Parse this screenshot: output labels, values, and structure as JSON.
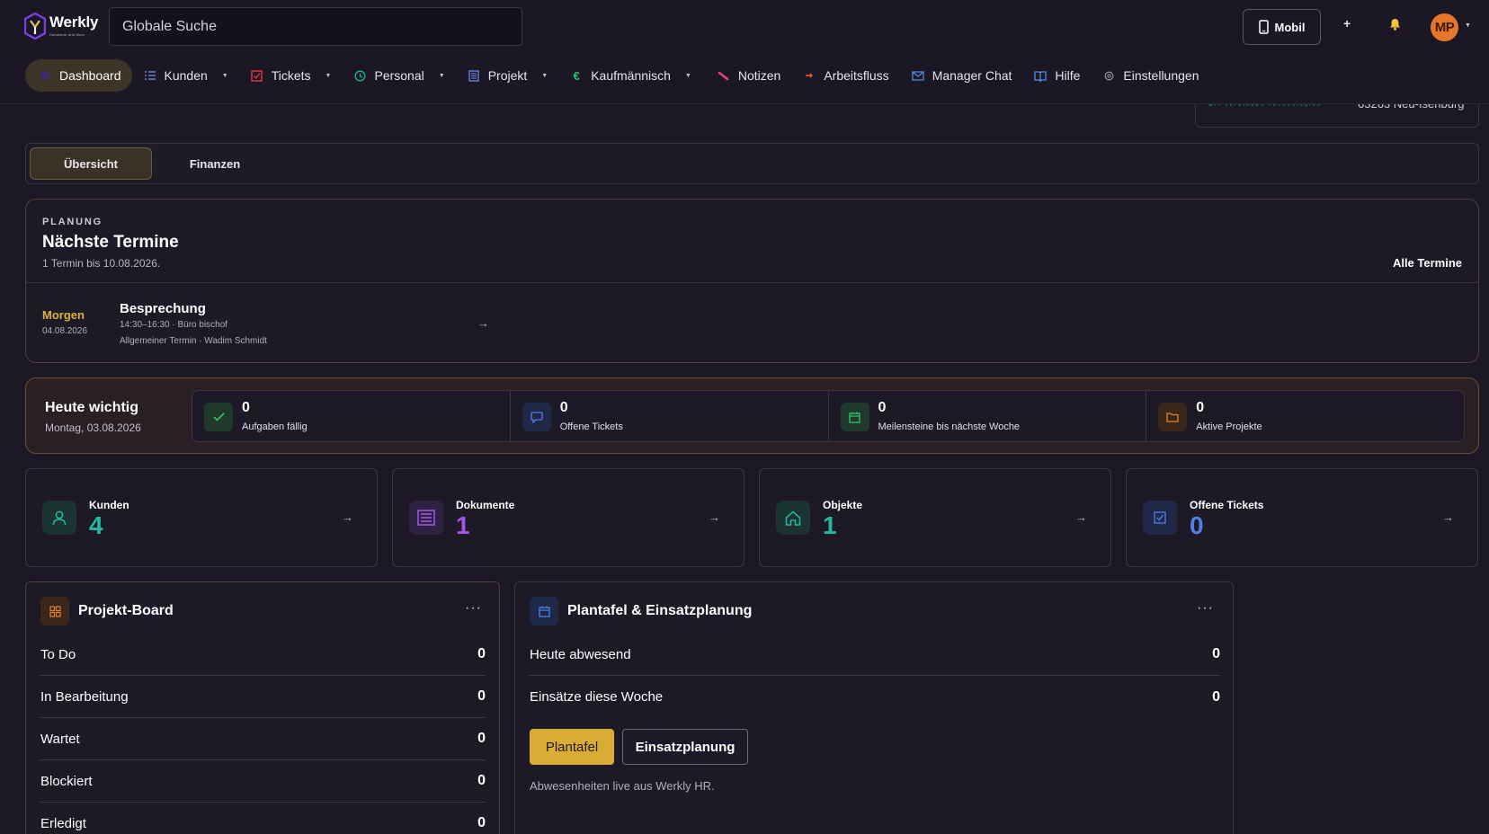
{
  "app": {
    "logo_text": "Werkly",
    "logo_sub": "Handwerk and More"
  },
  "search": {
    "placeholder": "Globale Suche"
  },
  "header": {
    "mobil_label": "Mobil",
    "plus_label": "+",
    "avatar_initials": "MP"
  },
  "nav": [
    {
      "label": "Dashboard",
      "icon": "dashboard-icon",
      "dropdown": false,
      "active": true
    },
    {
      "label": "Kunden",
      "icon": "list-icon",
      "dropdown": true
    },
    {
      "label": "Tickets",
      "icon": "checkbox-icon",
      "dropdown": true
    },
    {
      "label": "Personal",
      "icon": "clock-icon",
      "dropdown": true
    },
    {
      "label": "Projekt",
      "icon": "document-icon",
      "dropdown": true
    },
    {
      "label": "Kaufmännisch",
      "icon": "euro-icon",
      "dropdown": true
    },
    {
      "label": "Notizen",
      "icon": "pen-icon",
      "dropdown": false
    },
    {
      "label": "Arbeitsfluss",
      "icon": "flow-icon",
      "dropdown": false
    },
    {
      "label": "Manager Chat",
      "icon": "mail-icon",
      "dropdown": false
    },
    {
      "label": "Hilfe",
      "icon": "book-icon",
      "dropdown": false
    },
    {
      "label": "Einstellungen",
      "icon": "gear-icon",
      "dropdown": false
    }
  ],
  "address": {
    "slogan": "Wir verbinden Technologien",
    "city": "63263 Neu-Isenburg"
  },
  "tabs": {
    "overview": "Übersicht",
    "finance": "Finanzen"
  },
  "termine": {
    "kicker": "PLANUNG",
    "title": "Nächste Termine",
    "subtitle": "1 Termin bis 10.08.2026.",
    "all_link": "Alle Termine",
    "event": {
      "when": "Morgen",
      "date": "04.08.2026",
      "title": "Besprechung",
      "line1": "14:30–16:30 · Büro bischof",
      "line2": "Allgemeiner Termin · Wadim Schmidt"
    }
  },
  "heute": {
    "title": "Heute wichtig",
    "date": "Montag, 03.08.2026",
    "stats": [
      {
        "value": "0",
        "label": "Aufgaben fällig",
        "icon": "check-icon",
        "color": "#35c46a"
      },
      {
        "value": "0",
        "label": "Offene Tickets",
        "icon": "chat-icon",
        "color": "#4f7fe8"
      },
      {
        "value": "0",
        "label": "Meilensteine bis nächste Woche",
        "icon": "calendar-icon",
        "color": "#35c46a"
      },
      {
        "value": "0",
        "label": "Aktive Projekte",
        "icon": "folder-icon",
        "color": "#e4802f"
      }
    ]
  },
  "kpis": [
    {
      "label": "Kunden",
      "value": "4",
      "icon": "person-icon",
      "color": "#24b8a0"
    },
    {
      "label": "Dokumente",
      "value": "1",
      "icon": "list-icon",
      "color": "#a554e6"
    },
    {
      "label": "Objekte",
      "value": "1",
      "icon": "home-icon",
      "color": "#24b8a0"
    },
    {
      "label": "Offene Tickets",
      "value": "0",
      "icon": "checkbox-icon",
      "color": "#4f7fe8"
    }
  ],
  "board": {
    "title": "Projekt-Board",
    "rows": [
      {
        "label": "To Do",
        "value": "0"
      },
      {
        "label": "In Bearbeitung",
        "value": "0"
      },
      {
        "label": "Wartet",
        "value": "0"
      },
      {
        "label": "Blockiert",
        "value": "0"
      },
      {
        "label": "Erledigt",
        "value": "0"
      }
    ]
  },
  "plantafel": {
    "title": "Plantafel & Einsatzplanung",
    "rows": [
      {
        "label": "Heute abwesend",
        "value": "0"
      },
      {
        "label": "Einsätze diese Woche",
        "value": "0"
      }
    ],
    "primary_button": "Plantafel",
    "secondary_button": "Einsatzplanung",
    "note": "Abwesenheiten live aus Werkly HR."
  },
  "colors": {
    "accent": "#d9ad35",
    "background": "#1c1825",
    "card": "#1d1926"
  }
}
